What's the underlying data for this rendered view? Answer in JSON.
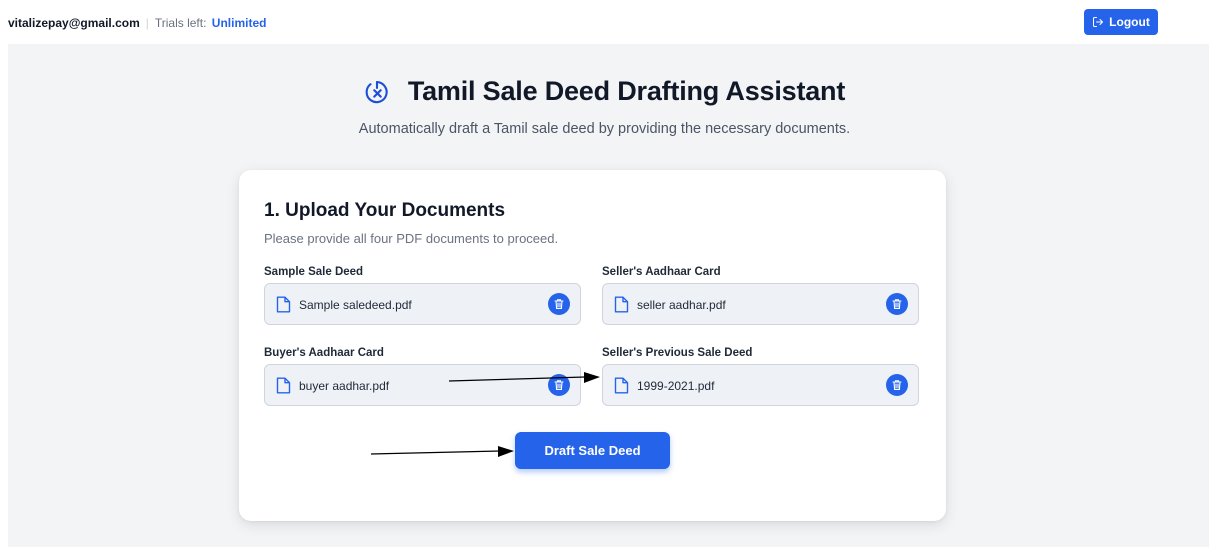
{
  "header": {
    "user_email": "vitalizepay@gmail.com",
    "separator": "|",
    "trials_label": "Trials left:",
    "trials_value": "Unlimited",
    "logout_label": "Logout"
  },
  "hero": {
    "title": "Tamil Sale Deed Drafting Assistant",
    "subtitle": "Automatically draft a Tamil sale deed by providing the necessary documents."
  },
  "upload": {
    "title": "1. Upload Your Documents",
    "description": "Please provide all four PDF documents to proceed.",
    "fields": [
      {
        "label": "Sample Sale Deed",
        "file": "Sample saledeed.pdf"
      },
      {
        "label": "Seller's Aadhaar Card",
        "file": "seller aadhar.pdf"
      },
      {
        "label": "Buyer's Aadhaar Card",
        "file": "buyer aadhar.pdf"
      },
      {
        "label": "Seller's Previous Sale Deed",
        "file": "1999-2021.pdf"
      }
    ],
    "submit_label": "Draft Sale Deed"
  },
  "colors": {
    "accent": "#2563eb",
    "background": "#f3f4f6",
    "file_box": "#eef2f7"
  },
  "icons": {
    "title": "timer-off-icon",
    "file": "file-icon",
    "delete": "trash-icon",
    "logout": "logout-icon"
  }
}
